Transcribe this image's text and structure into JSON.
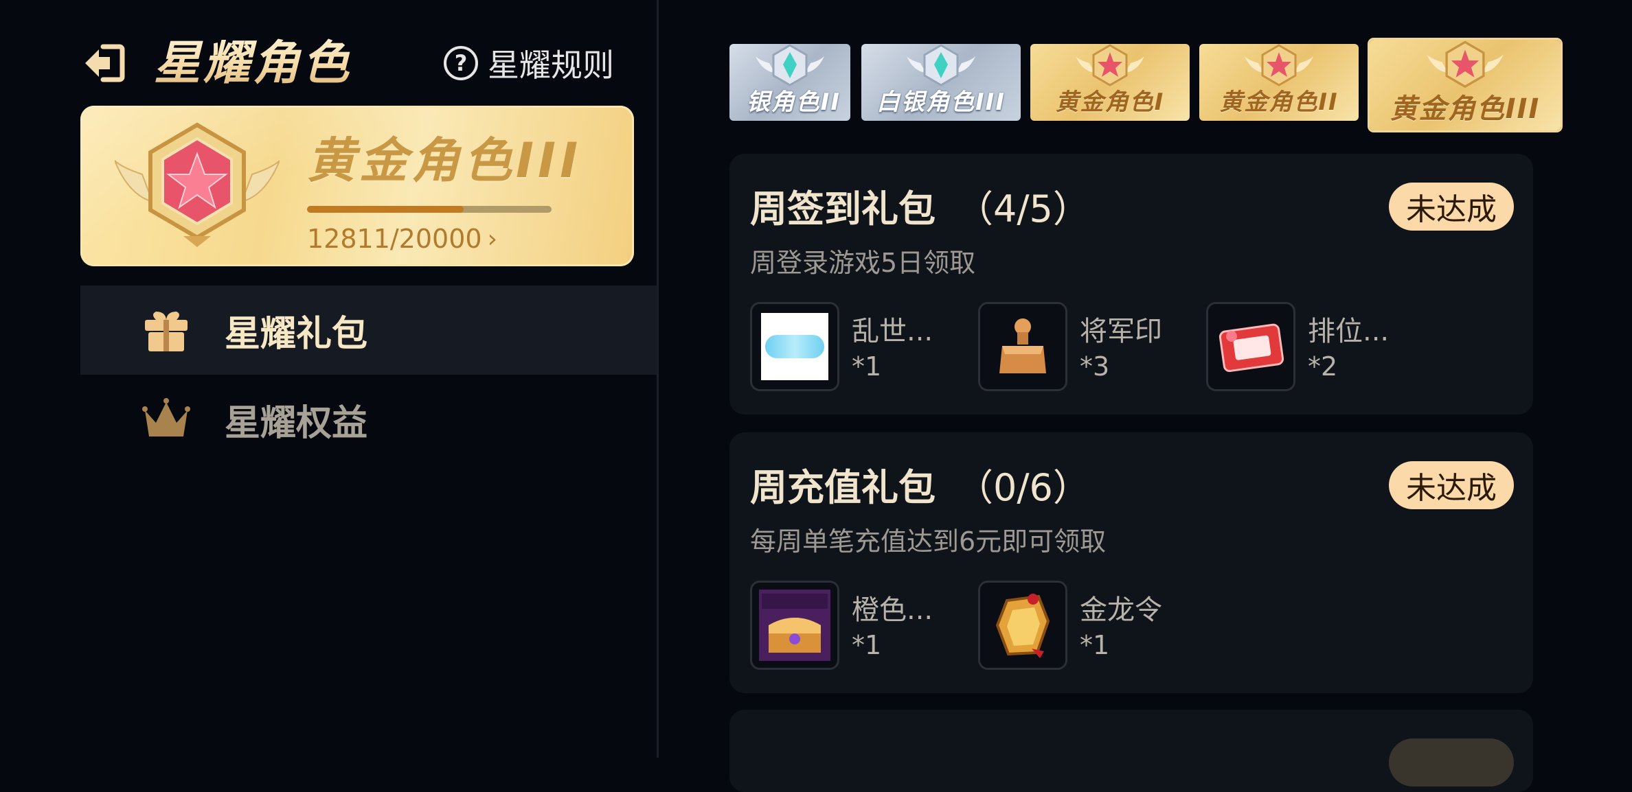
{
  "header": {
    "title": "星耀角色",
    "rules_label": "星耀规则",
    "back_icon": "exit-arrow-icon"
  },
  "rank_card": {
    "rank_name": "黄金角色III",
    "progress_current": 12811,
    "progress_max": 20000,
    "progress_text": "12811/20000",
    "chevron": "›",
    "emblem_icon": "gold-star-winged-emblem-icon"
  },
  "menu": {
    "items": [
      {
        "label": "星耀礼包",
        "icon": "gift-icon",
        "active": true
      },
      {
        "label": "星耀权益",
        "icon": "crown-icon",
        "active": false
      }
    ]
  },
  "tiers": [
    {
      "label": "银角色II",
      "style": "silver"
    },
    {
      "label": "白银角色III",
      "style": "silver"
    },
    {
      "label": "黄金角色I",
      "style": "gold"
    },
    {
      "label": "黄金角色II",
      "style": "gold"
    },
    {
      "label": "黄金角色III",
      "style": "gold",
      "current": true
    }
  ],
  "packs": [
    {
      "title": "周签到礼包",
      "count": "（4/5）",
      "desc": "周登录游戏5日领取",
      "status": "未达成",
      "rewards": [
        {
          "name": "乱世...",
          "qty": "*1",
          "icon": "card-art-icon"
        },
        {
          "name": "将军印",
          "qty": "*3",
          "icon": "bronze-seal-icon"
        },
        {
          "name": "排位...",
          "qty": "*2",
          "icon": "rank-protect-card-icon"
        }
      ]
    },
    {
      "title": "周充值礼包",
      "count": "（0/6）",
      "desc": "每周单笔充值达到6元即可领取",
      "status": "未达成",
      "rewards": [
        {
          "name": "橙色...",
          "qty": "*1",
          "icon": "fragment-chest-icon"
        },
        {
          "name": "金龙令",
          "qty": "*1",
          "icon": "gold-dragon-token-icon"
        }
      ]
    }
  ],
  "colors": {
    "background": "#05080f",
    "card": "#0f131a",
    "badge": "#fbd9a8",
    "gold_text": "#c99845",
    "progress_fill": "#c07a22"
  }
}
